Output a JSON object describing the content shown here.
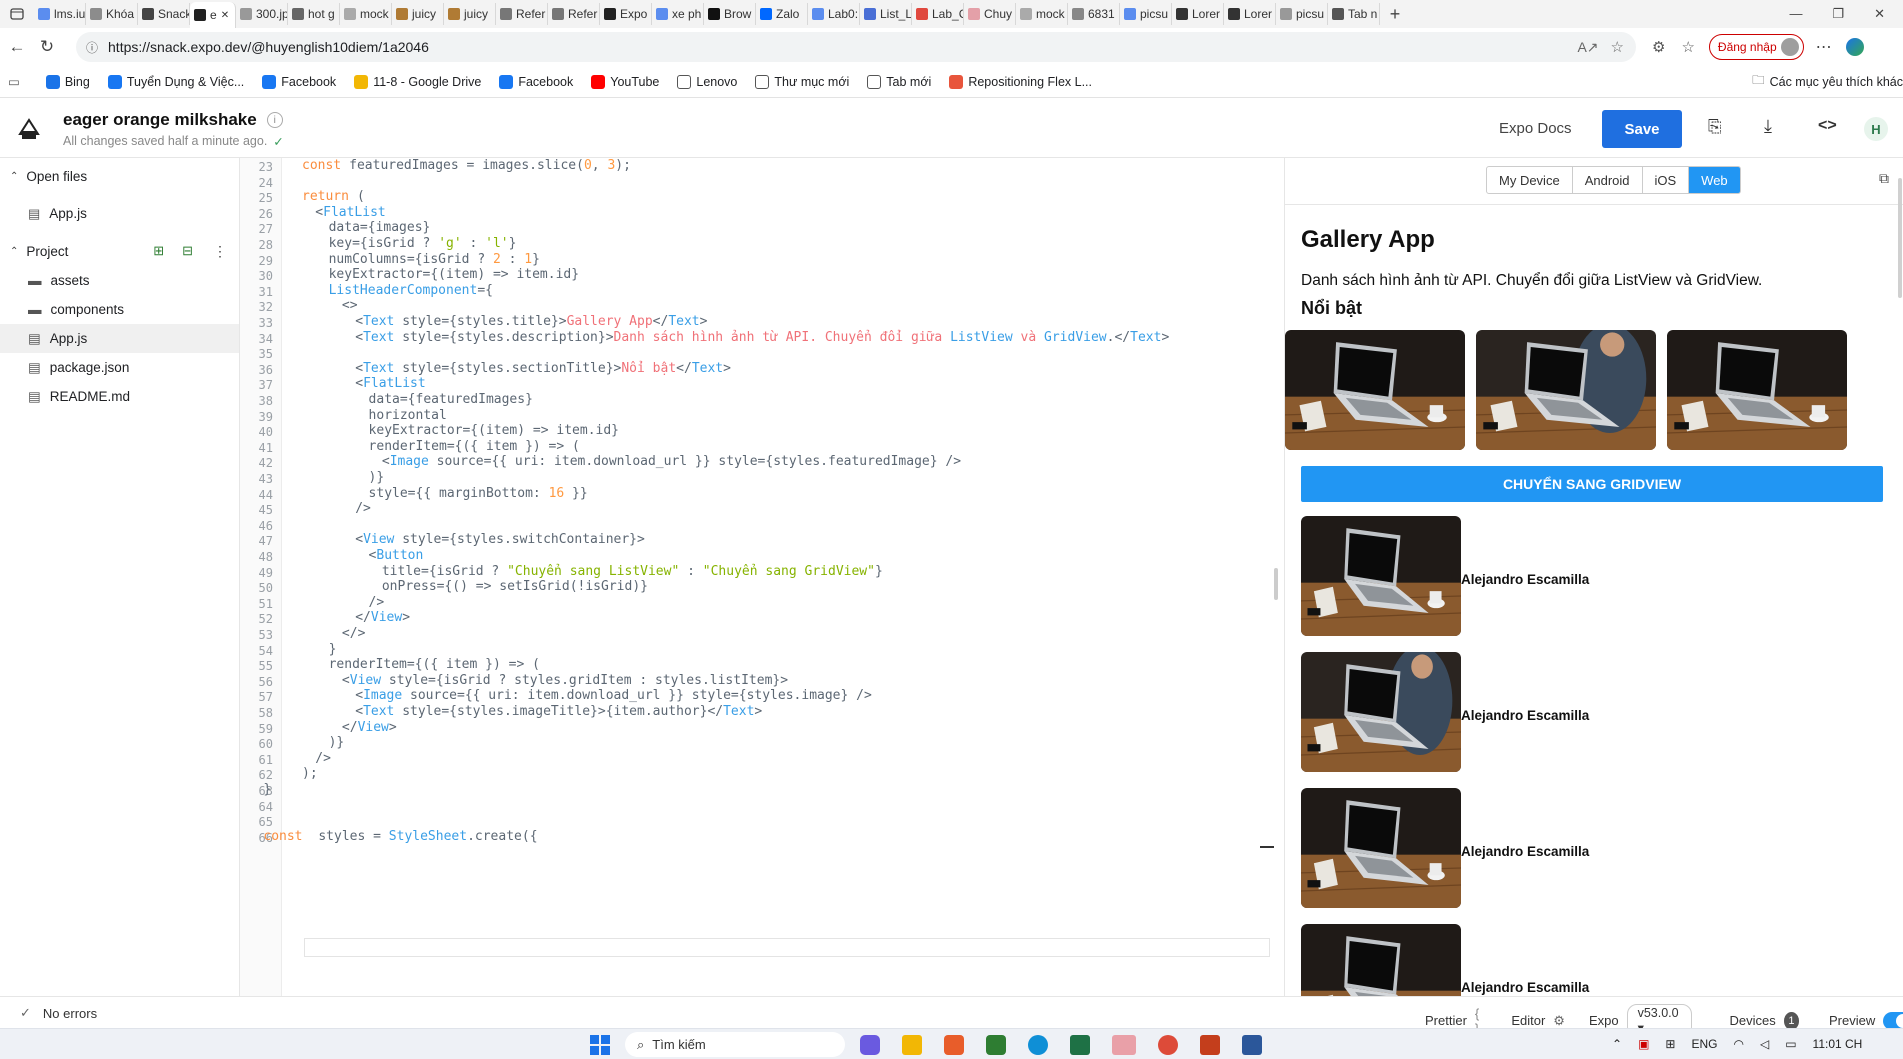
{
  "browser": {
    "tabs": [
      "lms.iu",
      "Khóa",
      "Snack",
      "e",
      "300.jp",
      "hot g",
      "mock",
      "juicy",
      "juicy",
      "Refer",
      "Refer",
      "Expo",
      "xe ph",
      "Brow",
      "Zalo",
      "Lab0:",
      "List_L",
      "Lab_C",
      "Chuy",
      "mock",
      "6831",
      "picsu",
      "Lorer",
      "Lorer",
      "picsu",
      "Tab n"
    ],
    "url": "https://snack.expo.dev/@huyenglish10diem/1a2046",
    "login_label": "Đăng nhập",
    "avatar_letter": "H",
    "bookmarks": [
      "Bing",
      "Tuyển Dụng & Việc...",
      "Facebook",
      "11-8 - Google Drive",
      "Facebook",
      "YouTube",
      "Lenovo",
      "Thư mục mới",
      "Tab mới",
      "Repositioning Flex L..."
    ],
    "other_bookmarks": "Các mục yêu thích khác"
  },
  "snack": {
    "project_name": "eager orange milkshake",
    "save_status": "All changes saved half a minute ago.",
    "expo_docs": "Expo Docs",
    "save_label": "Save"
  },
  "sidebar": {
    "open_files_label": "Open files",
    "open_files": [
      "App.js"
    ],
    "project_label": "Project",
    "items": [
      "assets",
      "components",
      "App.js",
      "package.json",
      "README.md"
    ]
  },
  "editor": {
    "line_numbers": [
      "23",
      "24",
      "25",
      "26",
      "27",
      "28",
      "29",
      "30",
      "31",
      "32",
      "33",
      "34",
      "35",
      "36",
      "37",
      "38",
      "39",
      "40",
      "41",
      "42",
      "43",
      "44",
      "45",
      "46",
      "47",
      "48",
      "49",
      "50",
      "51",
      "52",
      "53",
      "54",
      "55",
      "56",
      "57",
      "58",
      "59",
      "60",
      "61",
      "62",
      "63",
      "64",
      "65",
      "66"
    ],
    "lines": {
      "l23": [
        "const",
        "featuredImages = images.slice(",
        "0",
        ", ",
        "3",
        ");"
      ],
      "l25": [
        "return",
        "("
      ],
      "l26": [
        "<",
        "FlatList"
      ],
      "l27": "data={images}",
      "l28": [
        "key={isGrid ? ",
        "'g'",
        " : ",
        "'l'",
        "}"
      ],
      "l29": [
        "numColumns={isGrid ? ",
        "2",
        " : ",
        "1",
        "}"
      ],
      "l30": "keyExtractor={(item) => item.id}",
      "l31": [
        "ListHeaderComponent",
        "={"
      ],
      "l32": "<>",
      "l33": [
        "<",
        "Text",
        " style={styles.title}>",
        "Gallery App",
        "</",
        "Text",
        ">"
      ],
      "l34": [
        "<",
        "Text",
        " style={styles.description}>",
        "Danh sách hình ảnh từ API. Chuyển đổi giữa ",
        "ListView",
        " và ",
        "GridView",
        ".</",
        "Text",
        ">"
      ],
      "l36": [
        "<",
        "Text",
        " style={styles.sectionTitle}>",
        "Nổi bật",
        "</",
        "Text",
        ">"
      ],
      "l37": [
        "<",
        "FlatList"
      ],
      "l38": "data={featuredImages}",
      "l39": "horizontal",
      "l40": "keyExtractor={(item) => item.id}",
      "l41": "renderItem={({ item }) => (",
      "l42": [
        "<",
        "Image",
        " source={{ uri: item.download_url }} style={styles.featuredImage} />"
      ],
      "l43": ")}",
      "l44": [
        "style={{ marginBottom: ",
        "16",
        " }}"
      ],
      "l45": "/>",
      "l47": [
        "<",
        "View",
        " style={styles.switchContainer}>"
      ],
      "l48": [
        "<",
        "Button"
      ],
      "l49": [
        "title={isGrid ? ",
        "\"Chuyển sang ListView\"",
        " : ",
        "\"Chuyển sang GridView\"",
        "}"
      ],
      "l50": "onPress={() => setIsGrid(!isGrid)}",
      "l51": "/>",
      "l52": [
        "</",
        "View",
        ">"
      ],
      "l53": "</>",
      "l54": "}",
      "l55": "renderItem={({ item }) => (",
      "l56": [
        "<",
        "View",
        " style={isGrid ? styles.gridItem : styles.listItem}>"
      ],
      "l57": [
        "<",
        "Image",
        " source={{ uri: item.download_url }} style={styles.image} />"
      ],
      "l58": [
        "<",
        "Text",
        " style={styles.imageTitle}>{item.author}</",
        "Text",
        ">"
      ],
      "l59": [
        "</",
        "View",
        ">"
      ],
      "l60": ")}",
      "l61": "/>",
      "l62": ");",
      "l63": "}",
      "l66": [
        "const",
        " styles = ",
        "StyleSheet",
        ".create({"
      ]
    }
  },
  "preview": {
    "device_tabs": [
      "My Device",
      "Android",
      "iOS",
      "Web"
    ],
    "active_tab": "Web",
    "app_title": "Gallery App",
    "description": "Danh sách hình ảnh từ API. Chuyển đổi giữa ListView và GridView.",
    "section_title": "Nổi bật",
    "switch_button": "CHUYỂN SANG GRIDVIEW",
    "list_items": [
      {
        "author": "Alejandro Escamilla"
      },
      {
        "author": "Alejandro Escamilla"
      },
      {
        "author": "Alejandro Escamilla"
      },
      {
        "author": "Alejandro Escamilla"
      }
    ]
  },
  "statusbar": {
    "errors": "No errors",
    "prettier": "Prettier",
    "editor": "Editor",
    "expo": "Expo",
    "sdk_version": "v53.0.0",
    "devices": "Devices",
    "devices_count": "1",
    "preview": "Preview"
  },
  "taskbar": {
    "search_placeholder": "Tìm kiếm",
    "language": "ENG",
    "time": "11:01 CH"
  },
  "colors": {
    "accent": "#2196f3",
    "save_button": "#1f6fe0",
    "keyword": "#fa8d3e",
    "tag": "#399ee6",
    "string": "#86b300"
  }
}
